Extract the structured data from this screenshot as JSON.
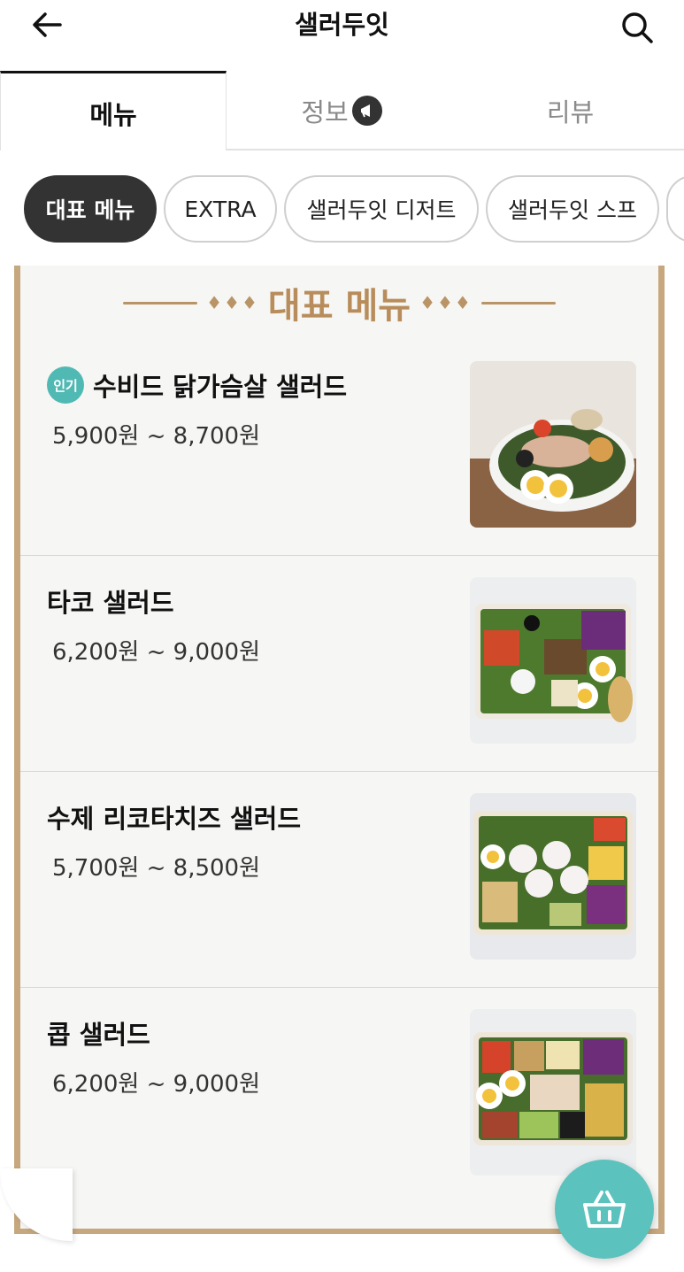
{
  "header": {
    "title": "샐러두잇"
  },
  "tabs": [
    {
      "label": "메뉴"
    },
    {
      "label": "정보"
    },
    {
      "label": "리뷰"
    }
  ],
  "categories": [
    {
      "label": "대표 메뉴"
    },
    {
      "label": "EXTRA"
    },
    {
      "label": "샐러두잇 디저트"
    },
    {
      "label": "샐러두잇 스프"
    }
  ],
  "section": {
    "title": "대표 메뉴"
  },
  "menu_items": [
    {
      "badge": "인기",
      "name": "수비드 닭가슴살 샐러드",
      "price": "5,900원 ~ 8,700원"
    },
    {
      "name": "타코 샐러드",
      "price": "6,200원 ~ 9,000원"
    },
    {
      "name": "수제 리코타치즈 샐러드",
      "price": "5,700원 ~ 8,500원"
    },
    {
      "name": "콥 샐러드",
      "price": "6,200원 ~ 9,000원"
    }
  ],
  "colors": {
    "accent_gold": "#b88d5b",
    "cart_teal": "#5cc2bd",
    "badge_teal": "#51b9b4"
  },
  "icons": {
    "back": "arrow-left-icon",
    "search": "search-icon",
    "info_badge": "megaphone-icon",
    "cart": "basket-icon"
  }
}
